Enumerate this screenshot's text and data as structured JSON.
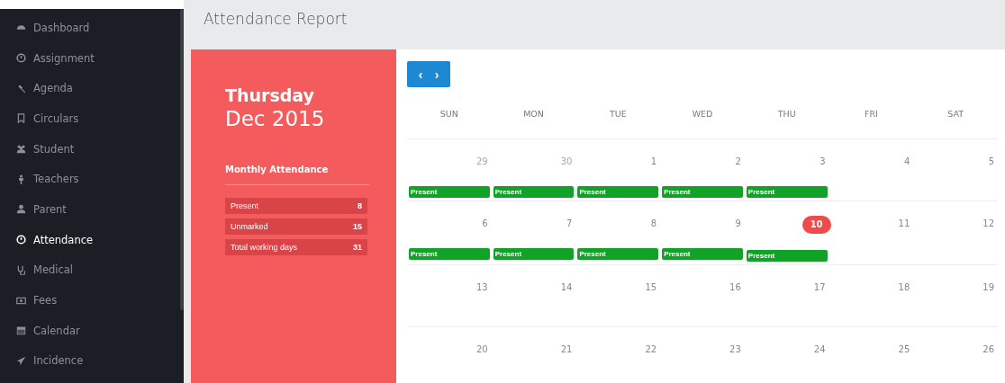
{
  "sidebar": {
    "items": [
      {
        "label": "Dashboard",
        "selected": false
      },
      {
        "label": "Assignment",
        "selected": false
      },
      {
        "label": "Agenda",
        "selected": false
      },
      {
        "label": "Circulars",
        "selected": false
      },
      {
        "label": "Student",
        "selected": false
      },
      {
        "label": "Teachers",
        "selected": false
      },
      {
        "label": "Parent",
        "selected": false
      },
      {
        "label": "Attendance",
        "selected": true
      },
      {
        "label": "Medical",
        "selected": false
      },
      {
        "label": "Fees",
        "selected": false
      },
      {
        "label": "Calendar",
        "selected": false
      },
      {
        "label": "Incidence",
        "selected": false
      }
    ]
  },
  "page": {
    "title": "Attendance Report"
  },
  "summary": {
    "weekday": "Thursday",
    "month": "Dec 2015",
    "heading": "Monthly Attendance",
    "stats": [
      {
        "label": "Present",
        "value": "8"
      },
      {
        "label": "Unmarked",
        "value": "15"
      },
      {
        "label": "Total working days",
        "value": "31"
      }
    ]
  },
  "calendar": {
    "nav": [
      "‹",
      "›"
    ],
    "weekdays": [
      "SUN",
      "MON",
      "TUE",
      "WED",
      "THU",
      "FRI",
      "SAT"
    ],
    "weeks": [
      {
        "days": [
          {
            "label": "29",
            "other_month": true,
            "today": false,
            "event": "Present"
          },
          {
            "label": "30",
            "other_month": true,
            "today": false,
            "event": "Present"
          },
          {
            "label": "1",
            "other_month": false,
            "today": false,
            "event": "Present"
          },
          {
            "label": "2",
            "other_month": false,
            "today": false,
            "event": "Present"
          },
          {
            "label": "3",
            "other_month": false,
            "today": false,
            "event": "Present"
          },
          {
            "label": "4",
            "other_month": false,
            "today": false
          },
          {
            "label": "5",
            "other_month": false,
            "today": false
          }
        ]
      },
      {
        "days": [
          {
            "label": "6",
            "other_month": false,
            "today": false,
            "event": "Present"
          },
          {
            "label": "7",
            "other_month": false,
            "today": false,
            "event": "Present"
          },
          {
            "label": "8",
            "other_month": false,
            "today": false,
            "event": "Present"
          },
          {
            "label": "9",
            "other_month": false,
            "today": false,
            "event": "Present"
          },
          {
            "label": "10",
            "other_month": false,
            "today": true,
            "event": "Present"
          },
          {
            "label": "11",
            "other_month": false,
            "today": false
          },
          {
            "label": "12",
            "other_month": false,
            "today": false
          }
        ]
      },
      {
        "days": [
          {
            "label": "13",
            "other_month": false,
            "today": false
          },
          {
            "label": "14",
            "other_month": false,
            "today": false
          },
          {
            "label": "15",
            "other_month": false,
            "today": false
          },
          {
            "label": "16",
            "other_month": false,
            "today": false
          },
          {
            "label": "17",
            "other_month": false,
            "today": false
          },
          {
            "label": "18",
            "other_month": false,
            "today": false
          },
          {
            "label": "19",
            "other_month": false,
            "today": false
          }
        ]
      },
      {
        "days": [
          {
            "label": "20",
            "other_month": false,
            "today": false
          },
          {
            "label": "21",
            "other_month": false,
            "today": false
          },
          {
            "label": "22",
            "other_month": false,
            "today": false
          },
          {
            "label": "23",
            "other_month": false,
            "today": false
          },
          {
            "label": "24",
            "other_month": false,
            "today": false
          },
          {
            "label": "25",
            "other_month": false,
            "today": false
          },
          {
            "label": "26",
            "other_month": false,
            "today": false
          }
        ]
      }
    ]
  }
}
